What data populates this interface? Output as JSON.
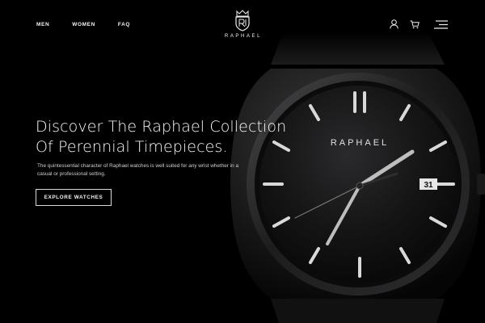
{
  "header": {
    "nav": {
      "men": "MEN",
      "women": "WOMEN",
      "faq": "FAQ"
    },
    "brand_name": "RAPHAEL",
    "icons": {
      "account": "user-icon",
      "cart": "cart-icon",
      "menu": "hamburger-menu-icon"
    }
  },
  "hero": {
    "title_line1": "Discover The Raphael Collection",
    "title_line2": "Of Perennial Timepieces.",
    "description": "The quintessential character of Raphael watches is well suited for any wrist whether in a casual or professional setting.",
    "cta_label": "EXPLORE WATCHES",
    "watch": {
      "dial_brand": "RAPHAEL",
      "date": "31"
    }
  },
  "colors": {
    "background": "#000000",
    "text": "#ffffff",
    "muted_text": "#cfcfcf"
  }
}
